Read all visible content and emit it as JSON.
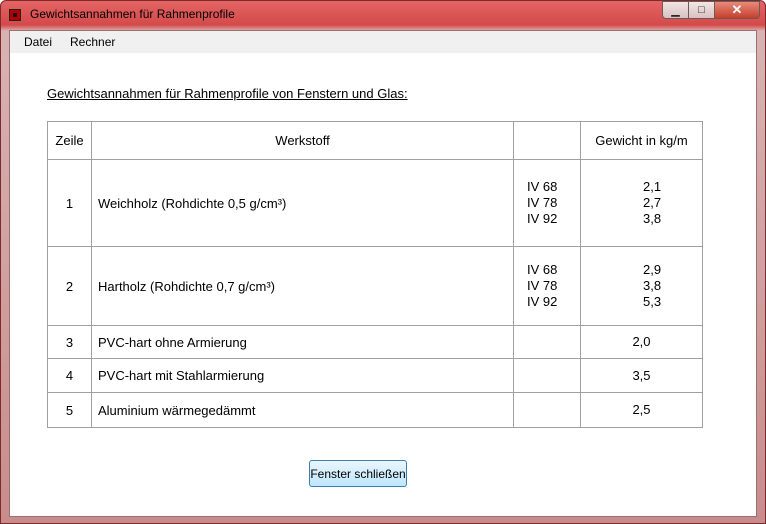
{
  "window": {
    "title": "Gewichtsannahmen für Rahmenprofile"
  },
  "menu": {
    "items": [
      "Datei",
      "Rechner"
    ]
  },
  "heading": "Gewichtsannahmen für Rahmenprofile von Fenstern und Glas:",
  "table": {
    "headers": {
      "zeile": "Zeile",
      "werkstoff": "Werkstoff",
      "typ": "",
      "gewicht": "Gewicht in kg/m"
    },
    "rows": [
      {
        "zeile": "1",
        "werkstoff": "Weichholz (Rohdichte 0,5 g/cm³)",
        "typ": [
          "IV 68",
          "IV 78",
          "IV 92"
        ],
        "gewicht": [
          "2,1",
          "2,7",
          "3,8"
        ]
      },
      {
        "zeile": "2",
        "werkstoff": "Hartholz (Rohdichte 0,7 g/cm³)",
        "typ": [
          "IV 68",
          "IV 78",
          "IV 92"
        ],
        "gewicht": [
          "2,9",
          "3,8",
          "5,3"
        ]
      },
      {
        "zeile": "3",
        "werkstoff": "PVC-hart ohne Armierung",
        "typ": [],
        "gewicht": [
          "2,0"
        ]
      },
      {
        "zeile": "4",
        "werkstoff": "PVC-hart mit Stahlarmierung",
        "typ": [],
        "gewicht": [
          "3,5"
        ]
      },
      {
        "zeile": "5",
        "werkstoff": "Aluminium wärmegedämmt",
        "typ": [],
        "gewicht": [
          "2,5"
        ]
      }
    ]
  },
  "buttons": {
    "close": "Fenster schließen"
  },
  "icons": {
    "app": "app-icon",
    "minimize": "minimize-icon",
    "maximize": "maximize-icon",
    "close": "close-icon"
  }
}
